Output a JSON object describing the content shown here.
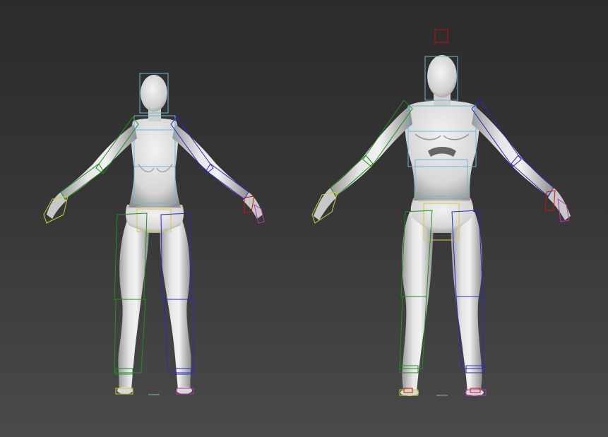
{
  "viewport": {
    "background_top": "#2b2b2b",
    "background_bottom": "#4a4a4a"
  },
  "colors": {
    "mesh_light": "#f0f0f0",
    "mesh_mid": "#c8c8c8",
    "mesh_dark": "#8a8a8a",
    "rig_left_side": "#1f8f1f",
    "rig_right_side": "#2a2ac8",
    "rig_spine": "#6fb8d8",
    "rig_pelvis": "#d8c840",
    "rig_left_hand": "#c8d030",
    "rig_right_hand": "#c01818",
    "rig_pinky": "#c030c0",
    "rig_root": "#c01010"
  },
  "scene": {
    "figures": [
      {
        "name": "female-mannequin",
        "icon": "female-figure-icon"
      },
      {
        "name": "male-mannequin",
        "icon": "male-figure-icon"
      }
    ]
  }
}
